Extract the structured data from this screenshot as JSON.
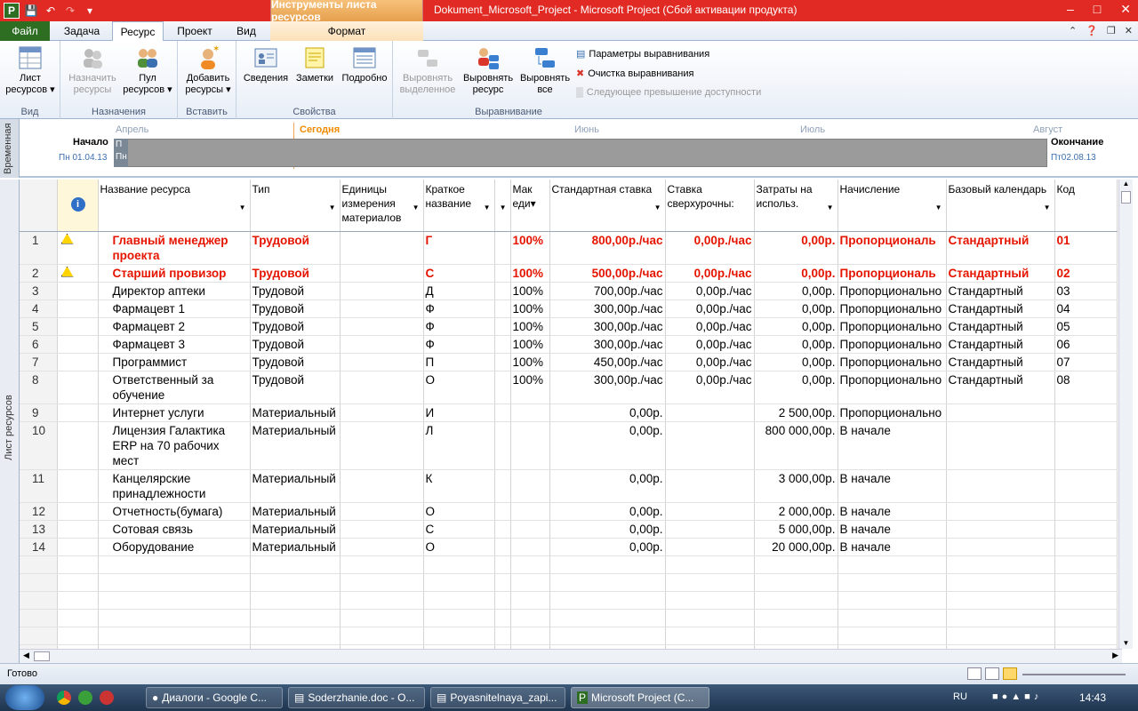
{
  "titlebar": {
    "context_tab": "Инструменты листа ресурсов",
    "window_title": "Dokument_Microsoft_Project  -  Microsoft Project (Сбой активации продукта)"
  },
  "tabs": [
    {
      "label": "Файл"
    },
    {
      "label": "Задача"
    },
    {
      "label": "Ресурс"
    },
    {
      "label": "Проект"
    },
    {
      "label": "Вид"
    },
    {
      "label": "Формат"
    }
  ],
  "ribbon": {
    "view_group": {
      "label": "Вид",
      "btn1": "Лист",
      "btn2": "ресурсов ▾"
    },
    "assign_group": {
      "label": "Назначения",
      "assign1": "Назначить",
      "assign2": "ресурсы",
      "pool1": "Пул",
      "pool2": "ресурсов ▾"
    },
    "insert_group": {
      "label": "Вставить",
      "add1": "Добавить",
      "add2": "ресурсы ▾"
    },
    "props_group": {
      "label": "Свойства",
      "info": "Сведения",
      "notes": "Заметки",
      "details": "Подробно"
    },
    "level_group": {
      "label": "Выравнивание",
      "sel1": "Выровнять",
      "sel2": "выделенное",
      "res1": "Выровнять",
      "res2": "ресурс",
      "all1": "Выровнять",
      "all2": "все",
      "options": "Параметры выравнивания",
      "clear": "Очистка выравнивания",
      "next": "Следующее превышение доступности"
    }
  },
  "timeline": {
    "side_label": "Временная",
    "start_label": "Начало",
    "start_date": "Пн 01.04.13",
    "end_label": "Окончание",
    "end_date": "Пт02.08.13",
    "today": "Сегодня",
    "months": [
      "Апрель",
      "Июнь",
      "Июль",
      "Август"
    ],
    "bar_p": "П",
    "bar_pn": "Пн"
  },
  "sheet": {
    "side_label": "Лист ресурсов",
    "columns": [
      "",
      "",
      "Название ресурса",
      "Тип",
      "Единицы измерения материалов",
      "Краткое название",
      "",
      "Мак еди▾",
      "Стандартная ставка",
      "Ставка сверхурочны:",
      "Затраты на использ.",
      "Начисление",
      "Базовый календарь",
      "Код"
    ],
    "rows": [
      {
        "id": "1",
        "warn": true,
        "name": "Главный менеджер проекта",
        "type": "Трудовой",
        "units": "",
        "short": "Г",
        "max": "100%",
        "std": "800,00р./час",
        "ovt": "0,00р./час",
        "cost": "0,00р.",
        "accrue": "Пропорциональ",
        "cal": "Стандартный",
        "code": "01"
      },
      {
        "id": "2",
        "warn": true,
        "name": "Старший провизор",
        "type": "Трудовой",
        "units": "",
        "short": "С",
        "max": "100%",
        "std": "500,00р./час",
        "ovt": "0,00р./час",
        "cost": "0,00р.",
        "accrue": "Пропорциональ",
        "cal": "Стандартный",
        "code": "02"
      },
      {
        "id": "3",
        "warn": false,
        "name": "Директор аптеки",
        "type": "Трудовой",
        "units": "",
        "short": "Д",
        "max": "100%",
        "std": "700,00р./час",
        "ovt": "0,00р./час",
        "cost": "0,00р.",
        "accrue": "Пропорционально",
        "cal": "Стандартный",
        "code": "03"
      },
      {
        "id": "4",
        "warn": false,
        "name": "Фармацевт 1",
        "type": "Трудовой",
        "units": "",
        "short": "Ф",
        "max": "100%",
        "std": "300,00р./час",
        "ovt": "0,00р./час",
        "cost": "0,00р.",
        "accrue": "Пропорционально",
        "cal": "Стандартный",
        "code": "04"
      },
      {
        "id": "5",
        "warn": false,
        "name": "Фармацевт 2",
        "type": "Трудовой",
        "units": "",
        "short": "Ф",
        "max": "100%",
        "std": "300,00р./час",
        "ovt": "0,00р./час",
        "cost": "0,00р.",
        "accrue": "Пропорционально",
        "cal": "Стандартный",
        "code": "05"
      },
      {
        "id": "6",
        "warn": false,
        "name": "Фармацевт 3",
        "type": "Трудовой",
        "units": "",
        "short": "Ф",
        "max": "100%",
        "std": "300,00р./час",
        "ovt": "0,00р./час",
        "cost": "0,00р.",
        "accrue": "Пропорционально",
        "cal": "Стандартный",
        "code": "06"
      },
      {
        "id": "7",
        "warn": false,
        "name": "Программист",
        "type": "Трудовой",
        "units": "",
        "short": "П",
        "max": "100%",
        "std": "450,00р./час",
        "ovt": "0,00р./час",
        "cost": "0,00р.",
        "accrue": "Пропорционально",
        "cal": "Стандартный",
        "code": "07"
      },
      {
        "id": "8",
        "warn": false,
        "name": "Ответственный за обучение",
        "type": "Трудовой",
        "units": "",
        "short": "О",
        "max": "100%",
        "std": "300,00р./час",
        "ovt": "0,00р./час",
        "cost": "0,00р.",
        "accrue": "Пропорционально",
        "cal": "Стандартный",
        "code": "08"
      },
      {
        "id": "9",
        "warn": false,
        "name": "Интернет услуги",
        "type": "Материальный",
        "units": "",
        "short": "И",
        "max": "",
        "std": "0,00р.",
        "ovt": "",
        "cost": "2 500,00р.",
        "accrue": "Пропорционально",
        "cal": "",
        "code": ""
      },
      {
        "id": "10",
        "warn": false,
        "name": "Лицензия Галактика ERP на 70 рабочих мест",
        "type": "Материальный",
        "units": "",
        "short": "Л",
        "max": "",
        "std": "0,00р.",
        "ovt": "",
        "cost": "800 000,00р.",
        "accrue": "В начале",
        "cal": "",
        "code": ""
      },
      {
        "id": "11",
        "warn": false,
        "name": "Канцелярские принадлежности",
        "type": "Материальный",
        "units": "",
        "short": "К",
        "max": "",
        "std": "0,00р.",
        "ovt": "",
        "cost": "3 000,00р.",
        "accrue": "В начале",
        "cal": "",
        "code": ""
      },
      {
        "id": "12",
        "warn": false,
        "name": "Отчетность(бумага)",
        "type": "Материальный",
        "units": "",
        "short": "О",
        "max": "",
        "std": "0,00р.",
        "ovt": "",
        "cost": "2 000,00р.",
        "accrue": "В начале",
        "cal": "",
        "code": ""
      },
      {
        "id": "13",
        "warn": false,
        "name": "Сотовая связь",
        "type": "Материальный",
        "units": "",
        "short": "С",
        "max": "",
        "std": "0,00р.",
        "ovt": "",
        "cost": "5 000,00р.",
        "accrue": "В начале",
        "cal": "",
        "code": ""
      },
      {
        "id": "14",
        "warn": false,
        "name": "Оборудование",
        "type": "Материальный",
        "units": "",
        "short": "О",
        "max": "",
        "std": "0,00р.",
        "ovt": "",
        "cost": "20 000,00р.",
        "accrue": "В начале",
        "cal": "",
        "code": ""
      }
    ]
  },
  "status": {
    "text": "Готово"
  },
  "taskbar": {
    "apps": [
      "Диалоги - Google C...",
      "Soderzhanie.doc - O...",
      "Poyasnitelnaya_zapi...",
      "Microsoft Project (C..."
    ],
    "lang": "RU",
    "time": "14:43"
  },
  "colors": {
    "title_red": "#e02a23",
    "overalloc": "#e51400",
    "file_tab": "#2d6e23"
  }
}
